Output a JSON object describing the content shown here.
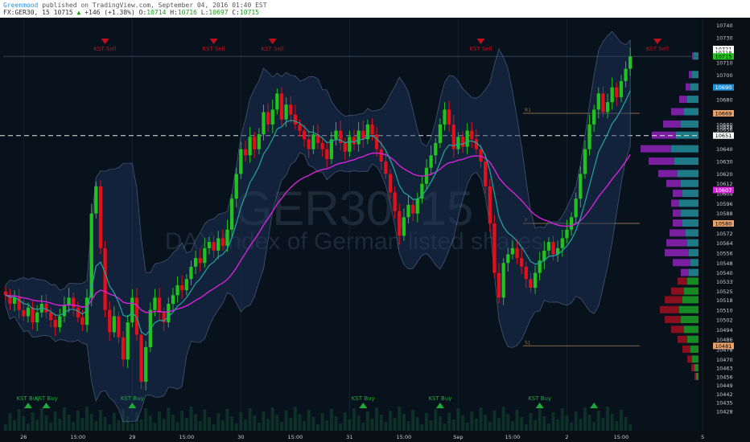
{
  "header": {
    "author": "Greenmood",
    "publisher_text": "published on TradingView.com, September 04, 2016 01:40 EST",
    "symbol": "FX:GER30, 15",
    "last": "10715",
    "change": "+146 (+1.38%)",
    "o_label": "O:",
    "o_value": "10714",
    "h_label": "H:",
    "h_value": "10716",
    "l_label": "L:",
    "l_value": "10697",
    "c_label": "C:",
    "c_value": "10715"
  },
  "watermark": {
    "symbol": "GER30, 15",
    "description": "DAX Index of German listed shares"
  },
  "colors": {
    "background": "#08121c",
    "bull_candle": "#22c31e",
    "bear_candle": "#e1101a",
    "ema_fast": "#25a5a0",
    "ema_slow": "#d524d8",
    "envelope": "#8ea5d8",
    "sell_marker": "#c0101e",
    "buy_marker": "#1fa83a"
  },
  "signals": {
    "sell": [
      "KST Sell",
      "KST Sell",
      "KST Sell",
      "KST Sell",
      "KST Sell"
    ],
    "buy": [
      "KST Buy",
      "KST Buy",
      "KST Buy",
      "KST Buy",
      "KST Buy",
      "KST Buy"
    ]
  },
  "levels": {
    "r1_label": "R1",
    "pp_label": "P",
    "s1_label": "S1"
  },
  "chart_data": {
    "type": "candlestick",
    "ylim": [
      10428,
      10745
    ],
    "y_ticks": [
      10740,
      10730,
      10710,
      10700,
      10690,
      10680,
      10669,
      10660,
      10658,
      10656,
      10651,
      10640,
      10630,
      10620,
      10612,
      10604,
      10596,
      10588,
      10580,
      10572,
      10564,
      10556,
      10548,
      10540,
      10533,
      10525,
      10518,
      10510,
      10502,
      10494,
      10486,
      10478,
      10470,
      10463,
      10456,
      10449,
      10442,
      10435,
      10428
    ],
    "price_badges": [
      {
        "value": "10721",
        "color": "#ffffff",
        "text_color": "#000000"
      },
      {
        "value": "10718",
        "color": "#ffffff",
        "text_color": "#000000"
      },
      {
        "value": "10715",
        "color": "#22c31e",
        "text_color": "#000000"
      },
      {
        "value": "10690",
        "color": "#1c8fd8",
        "text_color": "#ffffff"
      },
      {
        "value": "10669",
        "color": "#e8a36a",
        "text_color": "#000000"
      },
      {
        "value": "10651",
        "color": "#ffffff",
        "text_color": "#000000"
      },
      {
        "value": "10607",
        "color": "#d524d8",
        "text_color": "#ffffff"
      },
      {
        "value": "10580",
        "color": "#e8a36a",
        "text_color": "#000000"
      },
      {
        "value": "10481",
        "color": "#e8a36a",
        "text_color": "#000000"
      }
    ],
    "x_ticks": [
      "26",
      "15:00",
      "29",
      "15:00",
      "30",
      "15:00",
      "31",
      "15:00",
      "Sep",
      "15:00",
      "2",
      "15:00",
      "5"
    ],
    "x_tick_index": [
      4,
      16,
      28,
      40,
      52,
      64,
      76,
      88,
      100,
      112,
      124,
      136,
      154
    ],
    "sell_index": [
      22,
      46,
      59,
      105,
      144
    ],
    "buy_index": [
      5,
      9,
      28,
      79,
      96,
      118,
      130
    ],
    "pivot_r1": 10669,
    "pivot_p": 10580,
    "pivot_s1": 10481,
    "crosshair_price": 10651,
    "signal_high_price": 10715,
    "candles": [
      [
        10525,
        10522
      ],
      [
        10522,
        10515
      ],
      [
        10515,
        10520
      ],
      [
        10520,
        10510
      ],
      [
        10510,
        10505
      ],
      [
        10505,
        10512
      ],
      [
        10512,
        10500
      ],
      [
        10500,
        10508
      ],
      [
        10508,
        10515
      ],
      [
        10515,
        10508
      ],
      [
        10508,
        10502
      ],
      [
        10502,
        10496
      ],
      [
        10496,
        10505
      ],
      [
        10505,
        10514
      ],
      [
        10514,
        10520
      ],
      [
        10520,
        10512
      ],
      [
        10512,
        10504
      ],
      [
        10504,
        10498
      ],
      [
        10498,
        10520
      ],
      [
        10520,
        10588
      ],
      [
        10588,
        10610
      ],
      [
        10610,
        10560
      ],
      [
        10560,
        10510
      ],
      [
        10510,
        10492
      ],
      [
        10492,
        10505
      ],
      [
        10505,
        10488
      ],
      [
        10488,
        10470
      ],
      [
        10470,
        10500
      ],
      [
        10500,
        10520
      ],
      [
        10520,
        10490
      ],
      [
        10490,
        10452
      ],
      [
        10452,
        10480
      ],
      [
        10480,
        10510
      ],
      [
        10510,
        10520
      ],
      [
        10520,
        10508
      ],
      [
        10508,
        10500
      ],
      [
        10500,
        10515
      ],
      [
        10515,
        10522
      ],
      [
        10522,
        10530
      ],
      [
        10530,
        10526
      ],
      [
        10526,
        10535
      ],
      [
        10535,
        10545
      ],
      [
        10545,
        10552
      ],
      [
        10552,
        10548
      ],
      [
        10548,
        10560
      ],
      [
        10560,
        10565
      ],
      [
        10565,
        10558
      ],
      [
        10558,
        10568
      ],
      [
        10568,
        10562
      ],
      [
        10562,
        10575
      ],
      [
        10575,
        10600
      ],
      [
        10600,
        10620
      ],
      [
        10620,
        10640
      ],
      [
        10640,
        10635
      ],
      [
        10635,
        10650
      ],
      [
        10650,
        10640
      ],
      [
        10640,
        10652
      ],
      [
        10652,
        10670
      ],
      [
        10670,
        10660
      ],
      [
        10660,
        10672
      ],
      [
        10672,
        10685
      ],
      [
        10685,
        10664
      ],
      [
        10664,
        10676
      ],
      [
        10676,
        10668
      ],
      [
        10668,
        10660
      ],
      [
        10660,
        10655
      ],
      [
        10655,
        10648
      ],
      [
        10648,
        10640
      ],
      [
        10640,
        10652
      ],
      [
        10652,
        10645
      ],
      [
        10645,
        10640
      ],
      [
        10640,
        10632
      ],
      [
        10632,
        10648
      ],
      [
        10648,
        10655
      ],
      [
        10655,
        10645
      ],
      [
        10645,
        10638
      ],
      [
        10638,
        10650
      ],
      [
        10650,
        10644
      ],
      [
        10644,
        10655
      ],
      [
        10655,
        10648
      ],
      [
        10648,
        10660
      ],
      [
        10660,
        10652
      ],
      [
        10652,
        10640
      ],
      [
        10640,
        10630
      ],
      [
        10630,
        10620
      ],
      [
        10620,
        10605
      ],
      [
        10605,
        10590
      ],
      [
        10590,
        10570
      ],
      [
        10570,
        10585
      ],
      [
        10585,
        10595
      ],
      [
        10595,
        10588
      ],
      [
        10588,
        10600
      ],
      [
        10600,
        10612
      ],
      [
        10612,
        10625
      ],
      [
        10625,
        10635
      ],
      [
        10635,
        10645
      ],
      [
        10645,
        10660
      ],
      [
        10660,
        10672
      ],
      [
        10672,
        10660
      ],
      [
        10660,
        10640
      ],
      [
        10640,
        10650
      ],
      [
        10650,
        10642
      ],
      [
        10642,
        10655
      ],
      [
        10655,
        10648
      ],
      [
        10648,
        10640
      ],
      [
        10640,
        10630
      ],
      [
        10630,
        10610
      ],
      [
        10610,
        10580
      ],
      [
        10580,
        10540
      ],
      [
        10540,
        10520
      ],
      [
        10520,
        10548
      ],
      [
        10548,
        10555
      ],
      [
        10555,
        10560
      ],
      [
        10560,
        10552
      ],
      [
        10552,
        10545
      ],
      [
        10545,
        10535
      ],
      [
        10535,
        10528
      ],
      [
        10528,
        10540
      ],
      [
        10540,
        10550
      ],
      [
        10550,
        10558
      ],
      [
        10558,
        10565
      ],
      [
        10565,
        10555
      ],
      [
        10555,
        10560
      ],
      [
        10560,
        10568
      ],
      [
        10568,
        10575
      ],
      [
        10575,
        10585
      ],
      [
        10585,
        10600
      ],
      [
        10600,
        10620
      ],
      [
        10620,
        10640
      ],
      [
        10640,
        10660
      ],
      [
        10660,
        10672
      ],
      [
        10672,
        10685
      ],
      [
        10685,
        10670
      ],
      [
        10670,
        10678
      ],
      [
        10678,
        10690
      ],
      [
        10690,
        10682
      ],
      [
        10682,
        10695
      ],
      [
        10695,
        10705
      ],
      [
        10705,
        10715
      ]
    ],
    "volume_profile": [
      {
        "price": 10715,
        "buy": 6,
        "sell": 2
      },
      {
        "price": 10700,
        "buy": 8,
        "sell": 4
      },
      {
        "price": 10690,
        "buy": 10,
        "sell": 6
      },
      {
        "price": 10680,
        "buy": 14,
        "sell": 10
      },
      {
        "price": 10670,
        "buy": 18,
        "sell": 16
      },
      {
        "price": 10660,
        "buy": 22,
        "sell": 22
      },
      {
        "price": 10651,
        "buy": 28,
        "sell": 30
      },
      {
        "price": 10640,
        "buy": 34,
        "sell": 38
      },
      {
        "price": 10630,
        "buy": 30,
        "sell": 32
      },
      {
        "price": 10620,
        "buy": 26,
        "sell": 24
      },
      {
        "price": 10612,
        "buy": 22,
        "sell": 18
      },
      {
        "price": 10604,
        "buy": 20,
        "sell": 12
      },
      {
        "price": 10596,
        "buy": 24,
        "sell": 10
      },
      {
        "price": 10588,
        "buy": 22,
        "sell": 10
      },
      {
        "price": 10580,
        "buy": 20,
        "sell": 12
      },
      {
        "price": 10572,
        "buy": 16,
        "sell": 20
      },
      {
        "price": 10564,
        "buy": 14,
        "sell": 26
      },
      {
        "price": 10556,
        "buy": 12,
        "sell": 30
      },
      {
        "price": 10548,
        "buy": 10,
        "sell": 22
      },
      {
        "price": 10540,
        "buy": 12,
        "sell": 10
      },
      {
        "price": 10533,
        "buy": 14,
        "sell": 12
      },
      {
        "price": 10525,
        "buy": 18,
        "sell": 16
      },
      {
        "price": 10518,
        "buy": 20,
        "sell": 22
      },
      {
        "price": 10510,
        "buy": 24,
        "sell": 24
      },
      {
        "price": 10502,
        "buy": 22,
        "sell": 20
      },
      {
        "price": 10494,
        "buy": 18,
        "sell": 16
      },
      {
        "price": 10486,
        "buy": 14,
        "sell": 12
      },
      {
        "price": 10478,
        "buy": 10,
        "sell": 10
      },
      {
        "price": 10470,
        "buy": 8,
        "sell": 6
      },
      {
        "price": 10463,
        "buy": 5,
        "sell": 4
      },
      {
        "price": 10456,
        "buy": 3,
        "sell": 2
      }
    ]
  }
}
